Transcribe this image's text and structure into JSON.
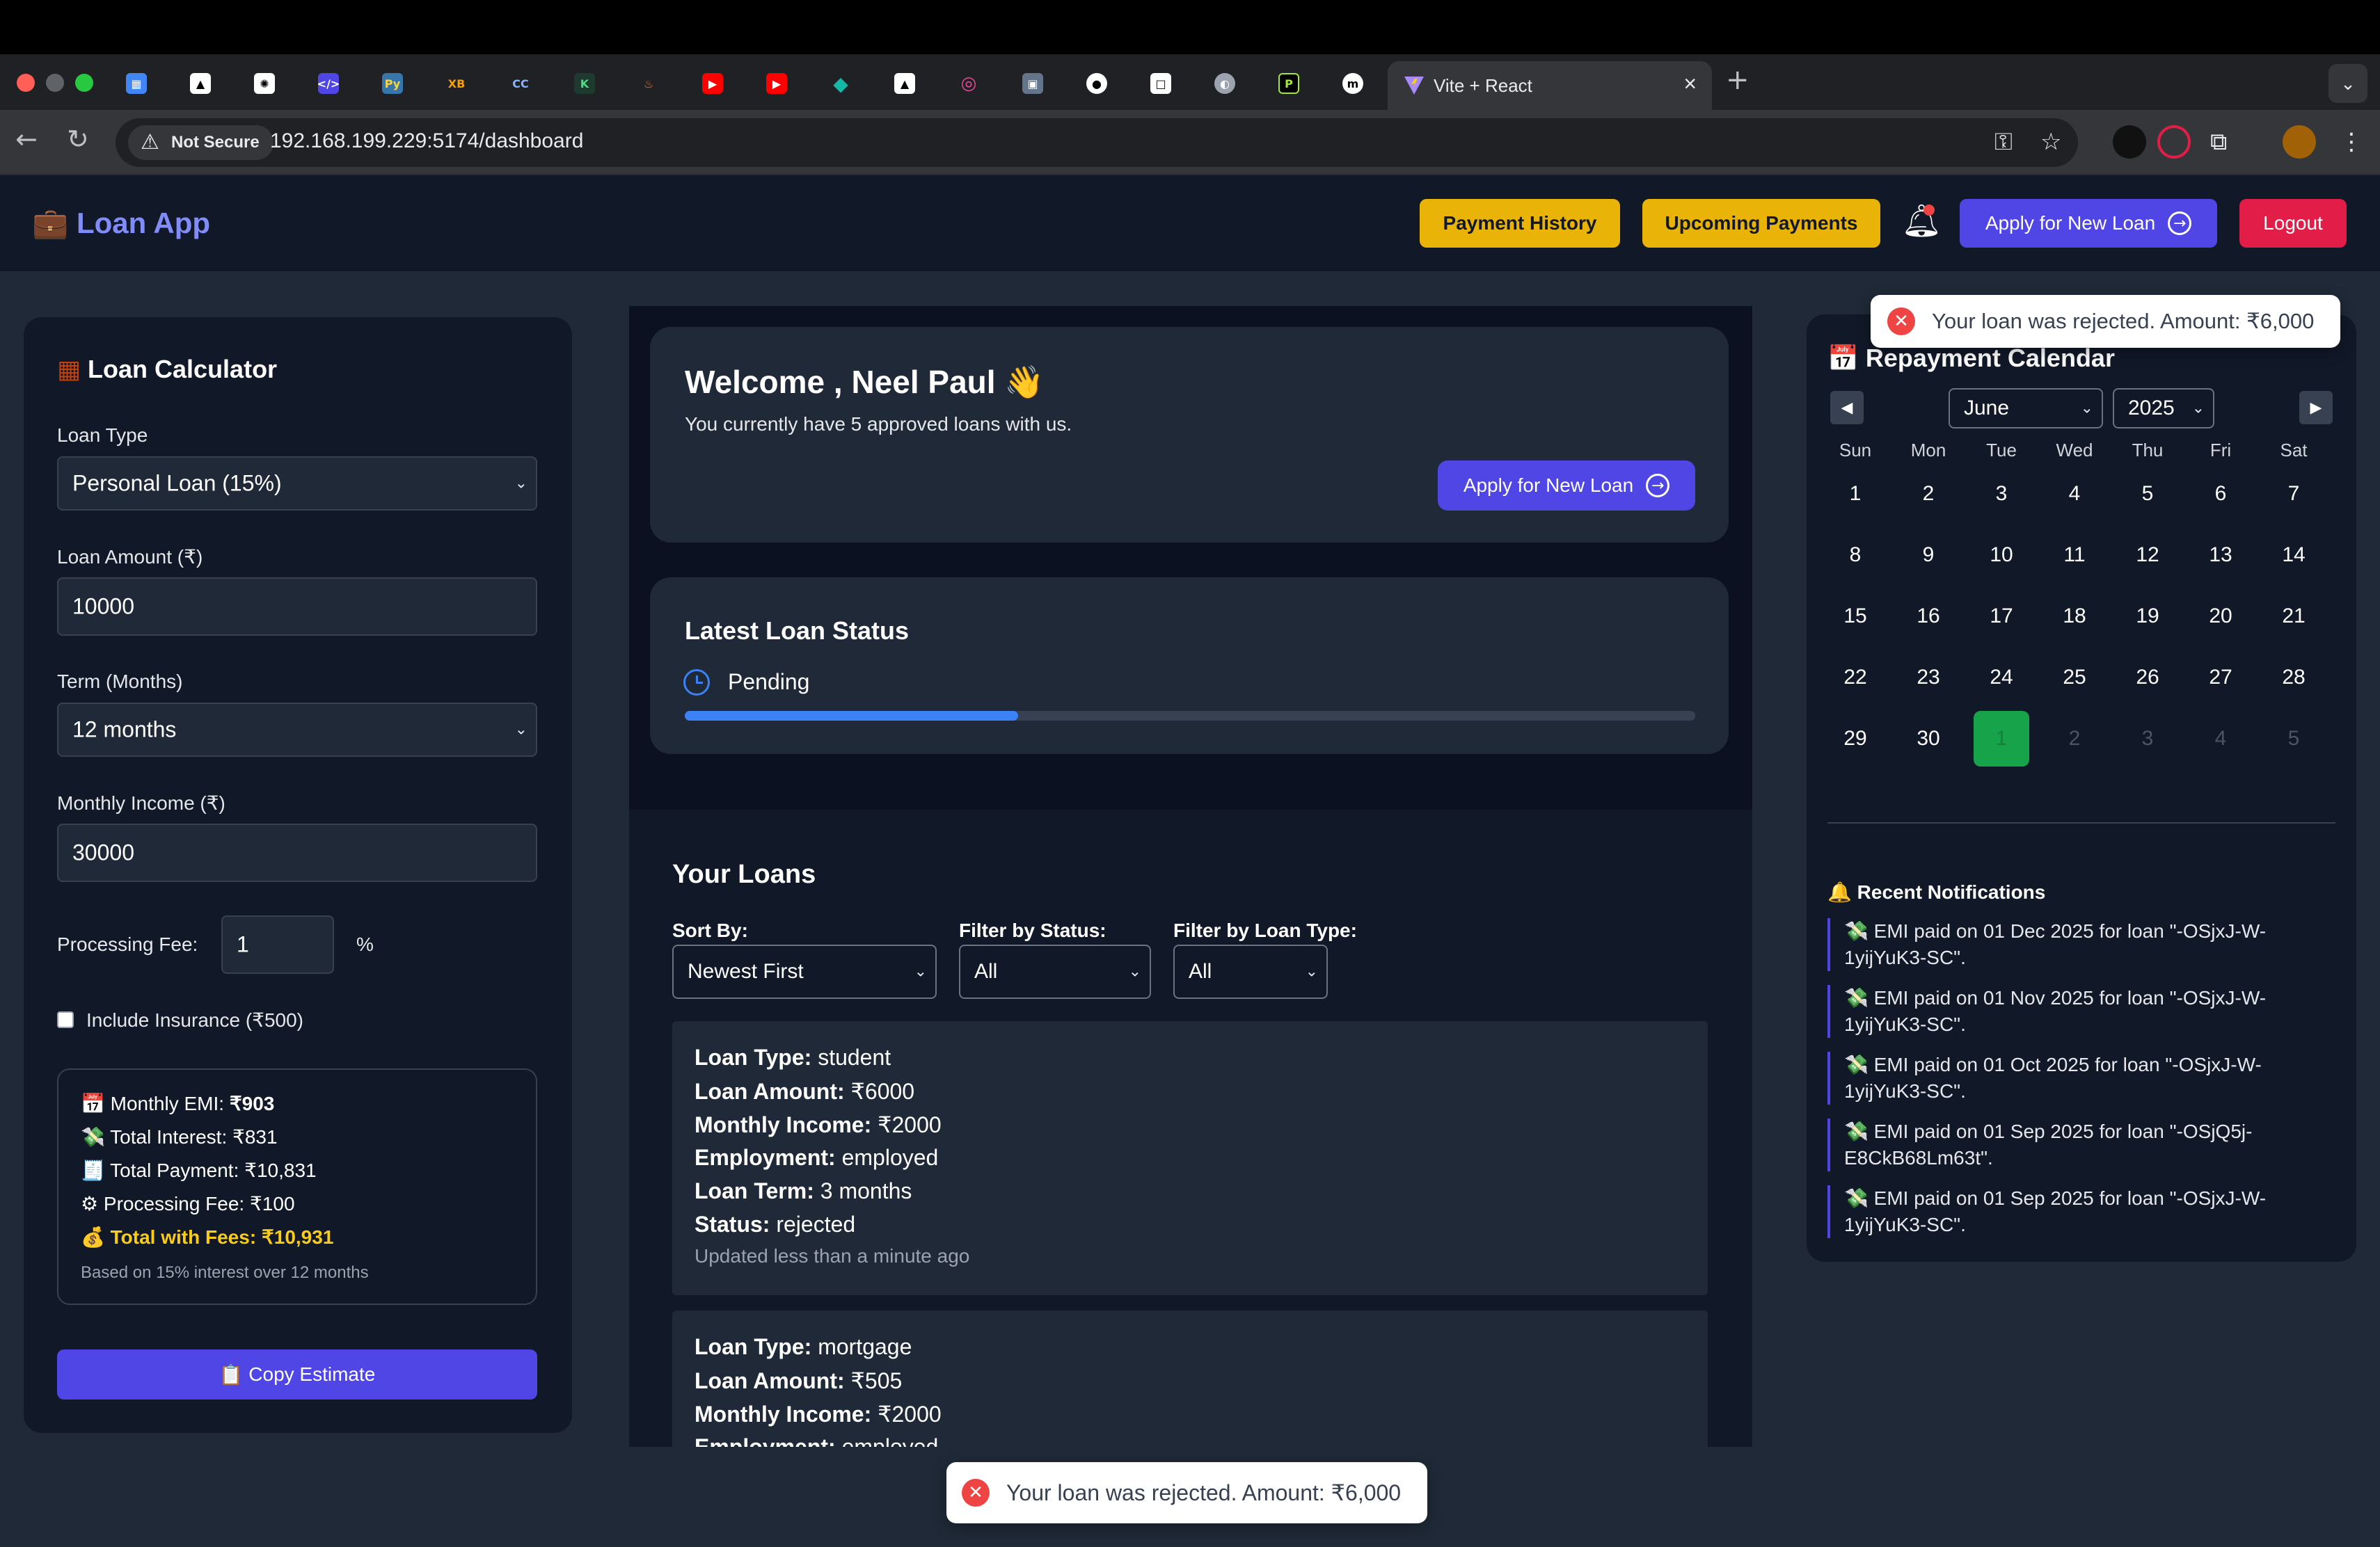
{
  "browser": {
    "tab_title": "Vite + React",
    "not_secure": "Not Secure",
    "url": "192.168.199.229:5174/dashboard"
  },
  "app": {
    "brand": "Loan App",
    "nav": {
      "payment_history": "Payment History",
      "upcoming_payments": "Upcoming Payments",
      "apply_new_loan": "Apply for New Loan",
      "logout": "Logout"
    }
  },
  "calculator": {
    "title": "Loan Calculator",
    "loan_type_label": "Loan Type",
    "loan_type_value": "Personal Loan (15%)",
    "amount_label": "Loan Amount (₹)",
    "amount_value": "10000",
    "term_label": "Term (Months)",
    "term_value": "12 months",
    "income_label": "Monthly Income (₹)",
    "income_value": "30000",
    "fee_label": "Processing Fee:",
    "fee_value": "1",
    "fee_unit": "%",
    "insurance_label": "Include Insurance (₹500)",
    "insurance_checked": false,
    "summary": {
      "emi_label": "Monthly EMI:",
      "emi_value": "₹903",
      "interest": "Total Interest: ₹831",
      "payment": "Total Payment: ₹10,831",
      "processing": "Processing Fee: ₹100",
      "total_fees": "Total with Fees: ₹10,931",
      "note": "Based on 15% interest over 12 months"
    },
    "copy_button": "Copy Estimate"
  },
  "welcome": {
    "title": "Welcome , Neel Paul",
    "subtitle": "You currently have 5 approved loans with us.",
    "apply_button": "Apply for New Loan"
  },
  "latest_status": {
    "title": "Latest Loan Status",
    "status": "Pending",
    "progress": 0.33
  },
  "loans": {
    "title": "Your Loans",
    "sort_label": "Sort By:",
    "sort_value": "Newest First",
    "status_filter_label": "Filter by Status:",
    "status_filter_value": "All",
    "type_filter_label": "Filter by Loan Type:",
    "type_filter_value": "All",
    "labels": {
      "type": "Loan Type:",
      "amount": "Loan Amount:",
      "income": "Monthly Income:",
      "employment": "Employment:",
      "term": "Loan Term:",
      "status": "Status:"
    },
    "items": [
      {
        "type": "student",
        "amount": "₹6000",
        "income": "₹2000",
        "employment": "employed",
        "term": "3 months",
        "status": "rejected",
        "updated": "Updated less than a minute ago"
      },
      {
        "type": "mortgage",
        "amount": "₹505",
        "income": "₹2000",
        "employment": "employed"
      }
    ]
  },
  "calendar": {
    "title": "Repayment Calendar",
    "month": "June",
    "year": "2025",
    "weekdays": [
      "Sun",
      "Mon",
      "Tue",
      "Wed",
      "Thu",
      "Fri",
      "Sat"
    ],
    "days": [
      "1",
      "2",
      "3",
      "4",
      "5",
      "6",
      "7",
      "8",
      "9",
      "10",
      "11",
      "12",
      "13",
      "14",
      "15",
      "16",
      "17",
      "18",
      "19",
      "20",
      "21",
      "22",
      "23",
      "24",
      "25",
      "26",
      "27",
      "28",
      "29",
      "30",
      "1",
      "2",
      "3",
      "4",
      "5"
    ],
    "highlighted_day": "1",
    "highlight_color": "#16a34a"
  },
  "notifications": {
    "title": "Recent Notifications",
    "items": [
      "EMI paid on 01 Dec 2025 for loan \"-OSjxJ-W-1yijYuK3-SC\".",
      "EMI paid on 01 Nov 2025 for loan \"-OSjxJ-W-1yijYuK3-SC\".",
      "EMI paid on 01 Oct 2025 for loan \"-OSjxJ-W-1yijYuK3-SC\".",
      "EMI paid on 01 Sep 2025 for loan \"-OSjQ5j-E8CkB68Lm63t\".",
      "EMI paid on 01 Sep 2025 for loan \"-OSjxJ-W-1yijYuK3-SC\"."
    ]
  },
  "toasts": {
    "top": "Your loan was rejected. Amount: ₹6,000",
    "bottom": "Your loan was rejected. Amount: ₹6,000"
  }
}
